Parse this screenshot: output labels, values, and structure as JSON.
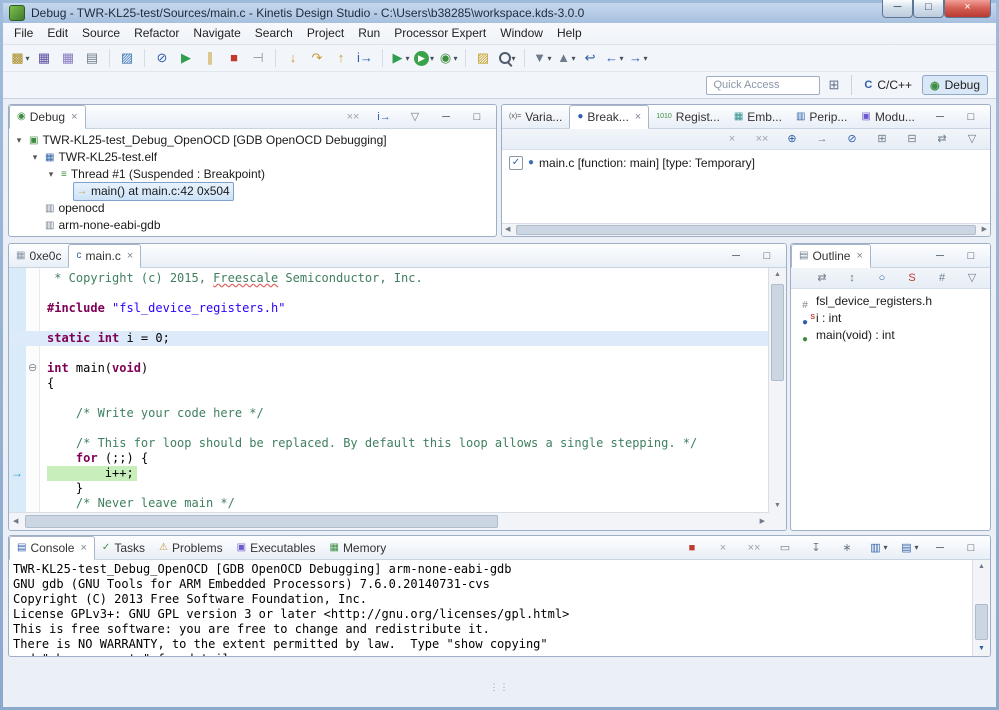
{
  "window": {
    "title": "Debug - TWR-KL25-test/Sources/main.c - Kinetis Design Studio - C:\\Users\\b38285\\workspace.kds-3.0.0",
    "controls": {
      "minimize": "─",
      "maximize": "□",
      "close": "×"
    }
  },
  "menubar": {
    "items": [
      "File",
      "Edit",
      "Source",
      "Refactor",
      "Navigate",
      "Search",
      "Project",
      "Run",
      "Processor Expert",
      "Window",
      "Help"
    ]
  },
  "toolbar": {
    "items": [
      {
        "name": "new-wizard-icon",
        "g": "▩",
        "c": "#A8891F",
        "dd": true
      },
      {
        "name": "save-icon",
        "g": "▦",
        "c": "#5B4FA0"
      },
      {
        "name": "save-all-icon",
        "g": "▦",
        "c": "#8579BE"
      },
      {
        "name": "print-icon",
        "g": "▤",
        "c": "#6E7B8A"
      },
      {
        "sep": true
      },
      {
        "name": "new-c-file-icon",
        "g": "▨",
        "c": "#3E78B5"
      },
      {
        "sep": true
      },
      {
        "name": "skip-all-breakpoints-icon",
        "g": "⊘",
        "c": "#2F5FA8"
      },
      {
        "name": "resume-icon",
        "g": "▶",
        "c": "#2E9E4F"
      },
      {
        "name": "suspend-icon",
        "g": "∥",
        "c": "#C79B2E"
      },
      {
        "name": "terminate-icon",
        "g": "■",
        "c": "#C0392B"
      },
      {
        "name": "disconnect-icon",
        "g": "⊣",
        "c": "#8A97A6"
      },
      {
        "sep": true
      },
      {
        "name": "step-into-icon",
        "g": "↓",
        "c": "#C79B2E"
      },
      {
        "name": "step-over-icon",
        "g": "↷",
        "c": "#C79B2E"
      },
      {
        "name": "step-return-icon",
        "g": "↑",
        "c": "#C79B2E"
      },
      {
        "name": "instruction-stepping-icon",
        "g": "i→",
        "c": "#2F5FA8"
      },
      {
        "sep": true
      },
      {
        "name": "external-tools-icon",
        "g": "▶",
        "c": "#2E9E4F",
        "dd": true
      },
      {
        "name": "run-icon",
        "g": "▶",
        "c": "#FFFFFF",
        "bg": "#3BA24C",
        "dd": true
      },
      {
        "name": "debug-icon",
        "g": "◉",
        "c": "#3E8E41",
        "dd": true
      },
      {
        "sep": true
      },
      {
        "name": "new-project-icon",
        "g": "▨",
        "c": "#C9A227"
      },
      {
        "name": "search-icon",
        "g": "",
        "c": "#4E5B6B",
        "dd": true
      },
      {
        "sep": true
      },
      {
        "name": "next-annotation-icon",
        "g": "▼",
        "c": "#6E7B8A",
        "dd": true
      },
      {
        "name": "previous-annotation-icon",
        "g": "▲",
        "c": "#6E7B8A",
        "dd": true
      },
      {
        "name": "last-edit-location-icon",
        "g": "↩",
        "c": "#2F5FA8"
      },
      {
        "name": "back-icon",
        "g": "←",
        "c": "#2F5FA8",
        "dd": true
      },
      {
        "name": "forward-icon",
        "g": "→",
        "c": "#2F5FA8",
        "dd": true
      }
    ]
  },
  "perspective_bar": {
    "quick_access": "Quick Access",
    "open_perspective_icon": "⊞",
    "perspectives": [
      {
        "name": "cpp",
        "icon_g": "C",
        "icon_c": "#2F5FA8",
        "label": "C/C++",
        "active": false
      },
      {
        "name": "debug",
        "icon_g": "◉",
        "icon_c": "#3E8E41",
        "label": "Debug",
        "active": true
      }
    ]
  },
  "debug_view": {
    "tab": {
      "label": "Debug",
      "icon_g": "◉",
      "icon_c": "#3E8E41"
    },
    "toolbar": [
      {
        "name": "remove-all-terminated-icon",
        "g": "××",
        "c": "#98A4B2"
      },
      {
        "name": "instruction-stepping-mode-icon",
        "g": "i→",
        "c": "#2F5FA8"
      },
      {
        "name": "view-menu-icon",
        "g": "▽",
        "c": "#6E7B8A"
      },
      {
        "name": "minimize-icon",
        "g": "─",
        "c": "#44505E"
      },
      {
        "name": "maximize-icon",
        "g": "□",
        "c": "#44505E"
      }
    ],
    "tree": [
      {
        "depth": 0,
        "expander": true,
        "icon_g": "▣",
        "icon_c": "#3E8E41",
        "label": "TWR-KL25-test_Debug_OpenOCD [GDB OpenOCD Debugging]"
      },
      {
        "depth": 1,
        "expander": true,
        "icon_g": "▦",
        "icon_c": "#2F5FA8",
        "label": "TWR-KL25-test.elf"
      },
      {
        "depth": 2,
        "expander": true,
        "icon_g": "≡",
        "icon_c": "#3E8E41",
        "label": "Thread #1 (Suspended : Breakpoint)"
      },
      {
        "depth": 3,
        "expander": false,
        "icon_g": "→",
        "icon_c": "#C79B2E",
        "label": "main() at main.c:42 0x504",
        "selected": true
      },
      {
        "depth": 1,
        "expander": false,
        "icon_g": "▥",
        "icon_c": "#6E7B8A",
        "label": "openocd"
      },
      {
        "depth": 1,
        "expander": false,
        "icon_g": "▥",
        "icon_c": "#6E7B8A",
        "label": "arm-none-eabi-gdb"
      }
    ]
  },
  "breakpoints_view": {
    "tabs": [
      {
        "name": "tab-variables",
        "icon_g": "(x)=",
        "icon_c": "#555555",
        "tiny": true,
        "label": "Varia..."
      },
      {
        "name": "tab-breakpoints",
        "icon_g": "●",
        "icon_c": "#2F5FA8",
        "label": "Break...",
        "active": true,
        "close": true
      },
      {
        "name": "tab-registers",
        "icon_g": "1010",
        "icon_c": "#3E8E41",
        "tiny": true,
        "label": "Regist..."
      },
      {
        "name": "tab-embedded-registers",
        "icon_g": "▦",
        "icon_c": "#2F8E8E",
        "label": "Emb..."
      },
      {
        "name": "tab-peripherals",
        "icon_g": "▥",
        "icon_c": "#2F5FA8",
        "label": "Perip..."
      },
      {
        "name": "tab-modules",
        "icon_g": "▣",
        "icon_c": "#6A5ACD",
        "label": "Modu..."
      }
    ],
    "win_icons": [
      {
        "name": "minimize-icon",
        "g": "─",
        "c": "#44505E"
      },
      {
        "name": "maximize-icon",
        "g": "□",
        "c": "#44505E"
      }
    ],
    "toolbar": [
      {
        "name": "remove-breakpoint-icon",
        "g": "×",
        "c": "#98A4B2"
      },
      {
        "name": "remove-all-breakpoints-icon",
        "g": "××",
        "c": "#98A4B2"
      },
      {
        "name": "show-supported-breakpoints-icon",
        "g": "⊕",
        "c": "#2F5FA8"
      },
      {
        "name": "go-to-file-icon",
        "g": "→",
        "c": "#6E7B8A"
      },
      {
        "name": "skip-all-breakpoints-icon",
        "g": "⊘",
        "c": "#2F5FA8"
      },
      {
        "name": "expand-all-icon",
        "g": "⊞",
        "c": "#6E7B8A"
      },
      {
        "name": "collapse-all-icon",
        "g": "⊟",
        "c": "#6E7B8A"
      },
      {
        "name": "link-with-debug-icon",
        "g": "⇄",
        "c": "#6E7B8A"
      },
      {
        "name": "view-menu-icon",
        "g": "▽",
        "c": "#6E7B8A"
      }
    ],
    "items": [
      {
        "checked": true,
        "icon_g": "●",
        "icon_c": "#3B6EB5",
        "label": "main.c [function: main] [type: Temporary]"
      }
    ]
  },
  "editor": {
    "tabs": [
      {
        "name": "tab-0xe0c",
        "icon_g": "▦",
        "icon_c": "#8A97A6",
        "label": "0xe0c"
      },
      {
        "name": "tab-main-c",
        "icon_g": "c",
        "icon_c": "#2F5FA8",
        "label": "main.c",
        "active": true,
        "close": true
      }
    ],
    "win_icons": [
      {
        "name": "minimize-icon",
        "g": "─",
        "c": "#44505E"
      },
      {
        "name": "maximize-icon",
        "g": "□",
        "c": "#44505E"
      }
    ],
    "code_lines": [
      {
        "s": [
          {
            "t": " * Copyright (c) 2015, ",
            "c": "cm"
          },
          {
            "t": "Freescale",
            "c": "cm sp"
          },
          {
            "t": " Semiconductor, Inc.",
            "c": "cm"
          }
        ]
      },
      {
        "s": []
      },
      {
        "s": [
          {
            "t": "#include ",
            "c": "dir"
          },
          {
            "t": "\"fsl_device_registers.h\"",
            "c": "str"
          }
        ]
      },
      {
        "s": []
      },
      {
        "s": [
          {
            "t": "static int",
            "c": "kw"
          },
          {
            "t": " i = 0;",
            "c": "pl"
          }
        ],
        "h": "cursor"
      },
      {
        "s": []
      },
      {
        "s": [
          {
            "t": "int",
            "c": "kw"
          },
          {
            "t": " main(",
            "c": "pl"
          },
          {
            "t": "void",
            "c": "kw"
          },
          {
            "t": ")",
            "c": "pl"
          }
        ],
        "fold": true
      },
      {
        "s": [
          {
            "t": "{",
            "c": "pl"
          }
        ]
      },
      {
        "s": []
      },
      {
        "s": [
          {
            "t": "    /* Write your code here */",
            "c": "cm"
          }
        ]
      },
      {
        "s": []
      },
      {
        "s": [
          {
            "t": "    /* This for loop should be replaced. By default this loop allows a single stepping. */",
            "c": "cm"
          }
        ]
      },
      {
        "s": [
          {
            "t": "    ",
            "c": "pl"
          },
          {
            "t": "for",
            "c": "kw"
          },
          {
            "t": " (;;) {",
            "c": "pl"
          }
        ]
      },
      {
        "s": [
          {
            "t": "        i++;",
            "c": "pl"
          }
        ],
        "h": "debug",
        "marker": "arrow"
      },
      {
        "s": [
          {
            "t": "    }",
            "c": "pl"
          }
        ]
      },
      {
        "s": [
          {
            "t": "    /* Never leave main */",
            "c": "cm"
          }
        ]
      }
    ]
  },
  "outline_view": {
    "tab": {
      "label": "Outline",
      "icon_g": "▤",
      "icon_c": "#6E7B8A",
      "close": true
    },
    "win_icons": [
      {
        "name": "minimize-icon",
        "g": "─",
        "c": "#44505E"
      },
      {
        "name": "maximize-icon",
        "g": "□",
        "c": "#44505E"
      }
    ],
    "toolbar": [
      {
        "name": "link-with-editor-icon",
        "g": "⇄",
        "c": "#6E7B8A"
      },
      {
        "name": "sort-icon",
        "g": "↕",
        "c": "#6E7B8A"
      },
      {
        "name": "hide-fields-icon",
        "g": "○",
        "c": "#2F5FA8"
      },
      {
        "name": "hide-static-members-icon",
        "g": "S",
        "c": "#C0392B"
      },
      {
        "name": "hide-non-public-icon",
        "g": "#",
        "c": "#6E7B8A"
      },
      {
        "name": "view-menu-icon",
        "g": "▽",
        "c": "#6E7B8A"
      }
    ],
    "items": [
      {
        "icon_g": "#",
        "icon_c": "#7A8794",
        "label": "fsl_device_registers.h"
      },
      {
        "icon_g": "●",
        "icon_c": "#2F5FA8",
        "decorator": "S",
        "label": "i : int"
      },
      {
        "icon_g": "●",
        "icon_c": "#3E8E41",
        "label": "main(void) : int"
      }
    ]
  },
  "console_view": {
    "tabs": [
      {
        "name": "tab-console",
        "icon_g": "▤",
        "icon_c": "#2F5FA8",
        "label": "Console",
        "active": true,
        "close": true
      },
      {
        "name": "tab-tasks",
        "icon_g": "✓",
        "icon_c": "#3E8E41",
        "label": "Tasks"
      },
      {
        "name": "tab-problems",
        "icon_g": "⚠",
        "icon_c": "#C79B2E",
        "label": "Problems"
      },
      {
        "name": "tab-executables",
        "icon_g": "▣",
        "icon_c": "#6A5ACD",
        "label": "Executables"
      },
      {
        "name": "tab-memory",
        "icon_g": "▦",
        "icon_c": "#3E8E41",
        "label": "Memory"
      }
    ],
    "toolbar": [
      {
        "name": "terminate-icon",
        "g": "■",
        "c": "#C0392B"
      },
      {
        "name": "remove-launch-icon",
        "g": "×",
        "c": "#98A4B2"
      },
      {
        "name": "remove-all-terminated-icon",
        "g": "××",
        "c": "#98A4B2"
      },
      {
        "name": "clear-console-icon",
        "g": "▭",
        "c": "#6E7B8A"
      },
      {
        "name": "scroll-lock-icon",
        "g": "↧",
        "c": "#6E7B8A"
      },
      {
        "name": "pin-console-icon",
        "g": "∗",
        "c": "#6E7B8A"
      },
      {
        "name": "display-selected-console-icon",
        "g": "▥",
        "c": "#2F5FA8",
        "dd": true
      },
      {
        "name": "open-console-icon",
        "g": "▤",
        "c": "#2F5FA8",
        "dd": true
      },
      {
        "name": "minimize-icon",
        "g": "─",
        "c": "#44505E"
      },
      {
        "name": "maximize-icon",
        "g": "□",
        "c": "#44505E"
      }
    ],
    "lines": [
      "TWR-KL25-test_Debug_OpenOCD [GDB OpenOCD Debugging] arm-none-eabi-gdb",
      "GNU gdb (GNU Tools for ARM Embedded Processors) 7.6.0.20140731-cvs",
      "Copyright (C) 2013 Free Software Foundation, Inc.",
      "License GPLv3+: GNU GPL version 3 or later <http://gnu.org/licenses/gpl.html>",
      "This is free software: you are free to change and redistribute it.",
      "There is NO WARRANTY, to the extent permitted by law.  Type \"show copying\"",
      "and \"show warranty\" for details."
    ]
  },
  "status_bar": {
    "grip": "⋮⋮"
  }
}
